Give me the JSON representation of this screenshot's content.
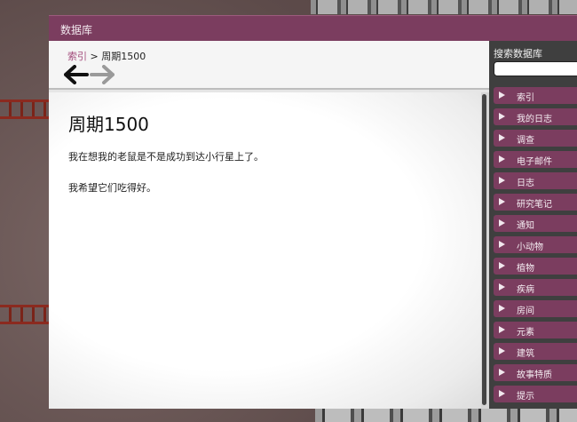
{
  "window": {
    "title": "数据库"
  },
  "breadcrumb": {
    "link": "索引",
    "separator": " > ",
    "current": "周期1500"
  },
  "article": {
    "title": "周期1500",
    "paragraphs": [
      "我在想我的老鼠是不是成功到达小行星上了。",
      "我希望它们吃得好。"
    ]
  },
  "sidebar": {
    "search_label": "搜索数据库",
    "search_value": "",
    "items": [
      {
        "label": "索引"
      },
      {
        "label": "我的日志"
      },
      {
        "label": "调查"
      },
      {
        "label": "电子邮件"
      },
      {
        "label": "日志"
      },
      {
        "label": "研究笔记"
      },
      {
        "label": "通知"
      },
      {
        "label": "小动物"
      },
      {
        "label": "植物"
      },
      {
        "label": "疾病"
      },
      {
        "label": "房间"
      },
      {
        "label": "元素"
      },
      {
        "label": "建筑"
      },
      {
        "label": "故事特质"
      },
      {
        "label": "提示"
      }
    ]
  },
  "colors": {
    "accent": "#7b3d5f",
    "link": "#a24b7b",
    "panel": "#3f3f3f"
  }
}
